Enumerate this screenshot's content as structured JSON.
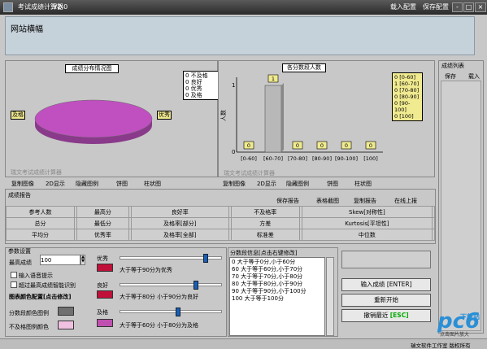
{
  "titlebar": {
    "title": "考试成绩计算器",
    "version": "V2.0",
    "menu_import": "载入配置",
    "menu_save": "保存配置",
    "min": "-",
    "max": "□",
    "close": "×"
  },
  "banner": {
    "text": "网站横幅"
  },
  "pie": {
    "title": "成绩分布情况图",
    "legend": [
      "0 不及格",
      "0 良好",
      "0 优秀",
      "0 及格"
    ],
    "left_tag": "及格",
    "right_tag": "优秀",
    "watermark": "瑞文考试成绩计算器",
    "buttons": [
      "复制图像",
      "2D显示",
      "隐藏图例",
      "饼图",
      "柱状图"
    ]
  },
  "bar": {
    "title": "各分数段人数",
    "y_axis_label": "人数",
    "legend": [
      "0 [0-60]",
      "1 [60-70]",
      "0 [70-80]",
      "0 [80-90]",
      "0 [90-100]",
      "0 [100]"
    ],
    "watermark": "瑞文考试成绩计算器",
    "buttons": [
      "复制图像",
      "2D显示",
      "隐藏图例",
      "饼图",
      "柱状图"
    ]
  },
  "chart_data": {
    "type": "bar",
    "categories": [
      "[0-60]",
      "[60-70]",
      "[70-80]",
      "[80-90]",
      "[90-100]",
      "[100]"
    ],
    "values": [
      0,
      1,
      0,
      0,
      0,
      0
    ],
    "title": "各分数段人数",
    "ylabel": "人数",
    "yticks": [
      "0",
      "1"
    ],
    "ylim": [
      0,
      1
    ]
  },
  "report": {
    "title": "成绩报告",
    "actions": [
      "保存报告",
      "表格截图",
      "复制报告",
      "在线上报"
    ],
    "rows": [
      [
        "参考人数",
        "",
        "最高分",
        "",
        "良好率",
        "",
        "不及格率",
        "",
        "Skew[对称性]",
        ""
      ],
      [
        "总分",
        "",
        "最低分",
        "",
        "及格率[部分]",
        "",
        "方差",
        "",
        "Kurtosis[平坦性]",
        ""
      ],
      [
        "平均分",
        "",
        "优秀率",
        "",
        "及格率[全部]",
        "",
        "标准差",
        "",
        "中位数",
        ""
      ]
    ]
  },
  "settings": {
    "title": "参数设置",
    "max_label": "最高成绩",
    "max_value": "100",
    "voice_label": "输入语音提示",
    "exceed_label": "超过最高成绩智能识别",
    "color_title": "图表颜色配置[点击修改]",
    "color_labels": [
      "分数段颜色图例",
      "不及格图例颜色"
    ],
    "colors": {
      "dark": "#707070",
      "pink": "#f0c0e0",
      "excellent": "#c0103a",
      "good": "#c0103a",
      "pass": "#c050b0",
      "pie": "#c050c0",
      "bar": "#b8b8b8"
    },
    "grades": [
      {
        "name": "优秀",
        "desc": "大于等于90分为优秀",
        "level": 0.85
      },
      {
        "name": "良好",
        "desc": "大于等于80分 小于90分为良好",
        "level": 0.75
      },
      {
        "name": "及格",
        "desc": "大于等于60分 小于80分为及格",
        "level": 0.57
      }
    ]
  },
  "segments": {
    "title": "分数段信息[点击右键修改]",
    "items": [
      "0    大于等于0分,小于60分",
      "60   大于等于60分,小于70分",
      "70   大于等于70分,小于80分",
      "80   大于等于80分,小于90分",
      "90   大于等于90分,小于100分",
      "100  大于等于100分"
    ]
  },
  "buttons": {
    "enter": "输入成绩 [ENTER]",
    "restart": "重新开始",
    "undo_prefix": "撤销最近",
    "undo_key": "[ESC]"
  },
  "scorelist": {
    "title": "成绩列表",
    "col1": "保存",
    "col2": "载入"
  },
  "footer": {
    "text": "瑞文软件工作室 版权所有",
    "overlay": "pc6",
    "overlay2": "下载站",
    "overlay3": "点击图片放大"
  }
}
